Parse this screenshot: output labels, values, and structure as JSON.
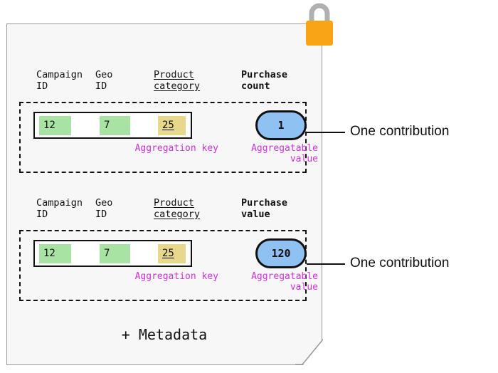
{
  "lock": {
    "icon": "lock-icon",
    "shackle_color": "#b0b0b0",
    "body_color": "#f9a317"
  },
  "card": {
    "background": "#f7f7f7",
    "border_color": "#9a9a9a",
    "metadata_label": "+ Metadata"
  },
  "colors": {
    "key_green": "#a8e3a3",
    "key_yellow": "#e8d88c",
    "value_blue": "#8fc2f2",
    "annotation_magenta": "#cc33dd",
    "outline_black": "#111111"
  },
  "groups": [
    {
      "name": "purchase-count-contribution",
      "headers": {
        "campaign": "Campaign\nID",
        "geo": "Geo\nID",
        "product": "Product\ncategory",
        "metric": "Purchase\ncount"
      },
      "key_cells": [
        {
          "name": "campaign-id-cell",
          "value": "12",
          "color": "#a8e3a3",
          "underlined": false
        },
        {
          "name": "geo-id-cell",
          "value": "7",
          "color": "#a8e3a3",
          "underlined": false
        },
        {
          "name": "product-category-cell",
          "value": "25",
          "color": "#e8d88c",
          "underlined": true
        }
      ],
      "aggregatable_value": "1",
      "annotations": {
        "key": "Aggregation key",
        "value": "Aggregatable\nvalue"
      },
      "callout": "One contribution"
    },
    {
      "name": "purchase-value-contribution",
      "headers": {
        "campaign": "Campaign\nID",
        "geo": "Geo\nID",
        "product": "Product\ncategory",
        "metric": "Purchase\nvalue"
      },
      "key_cells": [
        {
          "name": "campaign-id-cell",
          "value": "12",
          "color": "#a8e3a3",
          "underlined": false
        },
        {
          "name": "geo-id-cell",
          "value": "7",
          "color": "#a8e3a3",
          "underlined": false
        },
        {
          "name": "product-category-cell",
          "value": "25",
          "color": "#e8d88c",
          "underlined": true
        }
      ],
      "aggregatable_value": "120",
      "annotations": {
        "key": "Aggregation key",
        "value": "Aggregatable\nvalue"
      },
      "callout": "One contribution"
    }
  ]
}
